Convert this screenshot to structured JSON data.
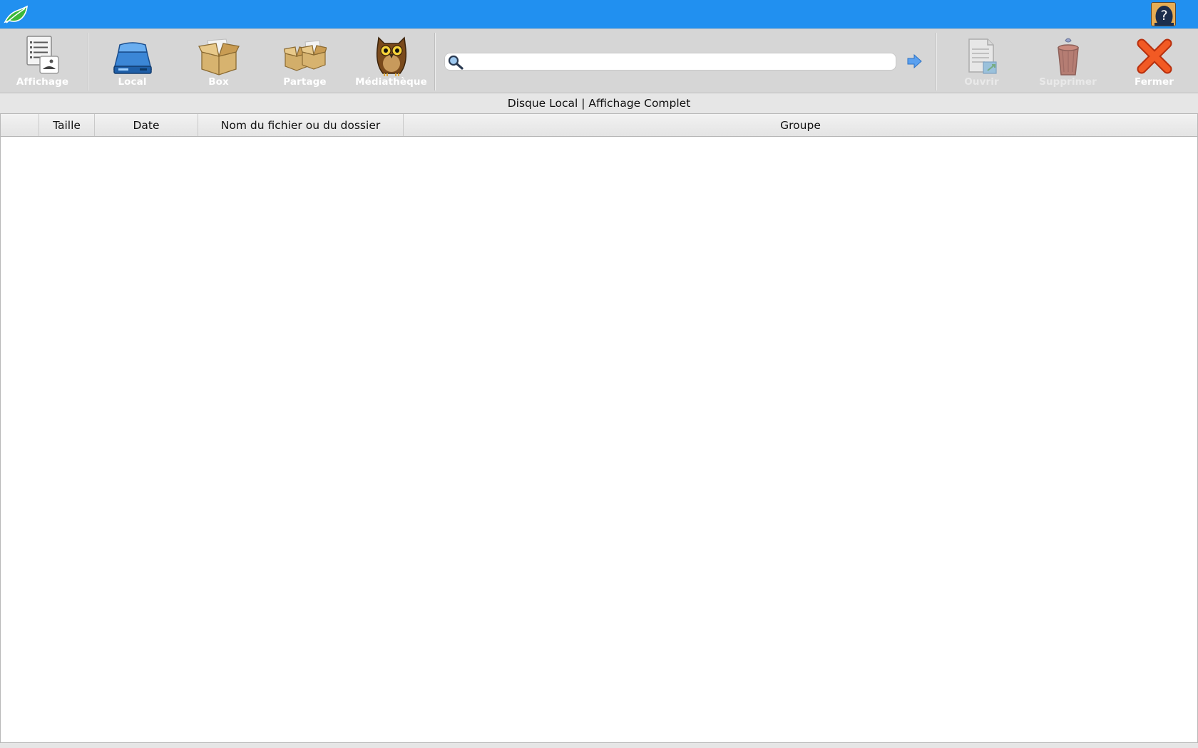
{
  "titlebar": {
    "logo_icon": "leaf-icon",
    "help_icon": "help-question-icon",
    "accent_color": "#2190f0"
  },
  "toolbar": {
    "view_label": "Affichage",
    "local_label": "Local",
    "box_label": "Box",
    "share_label": "Partage",
    "media_label": "Médiathèque",
    "open_label": "Ouvrir",
    "delete_label": "Supprimer",
    "close_label": "Fermer",
    "icons": [
      "list-view-icon",
      "hard-drive-icon",
      "box-icon",
      "shared-boxes-icon",
      "owl-icon",
      "open-document-icon",
      "trash-icon",
      "close-x-icon"
    ]
  },
  "search": {
    "placeholder": "",
    "value": "",
    "icon": "magnifier-icon",
    "go_icon": "arrow-right-icon"
  },
  "status": {
    "text": "Disque Local | Affichage Complet"
  },
  "table": {
    "columns": [
      "",
      "Taille",
      "Date",
      "Nom du fichier ou du dossier",
      "Groupe"
    ],
    "rows": []
  }
}
